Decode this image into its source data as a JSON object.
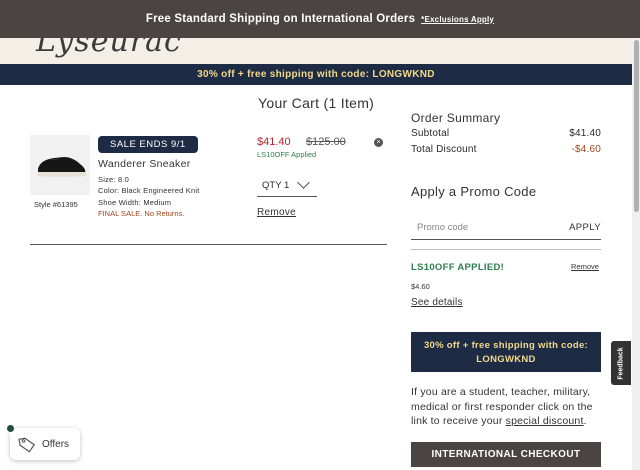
{
  "top_banner": {
    "text": "Free Standard Shipping on International Orders",
    "exclusions": "*Exclusions Apply"
  },
  "promo_bar": {
    "text": "30% off + free shipping with code: LONGWKND"
  },
  "cart": {
    "title": "Your Cart (1 Item)",
    "item": {
      "badge": "SALE ENDS 9/1",
      "name": "Wanderer Sneaker",
      "size": "Size: 8.0",
      "color": "Color: Black Engineered Knit",
      "width": "Shoe Width: Medium",
      "final_sale": "FINAL SALE. No Returns.",
      "style": "Style #61395",
      "sale_price": "$41.40",
      "original_price": "$125.00",
      "promo_applied": "LS10OFF Applied",
      "qty": "QTY 1",
      "remove": "Remove"
    }
  },
  "summary": {
    "title": "Order Summary",
    "subtotal_label": "Subtotal",
    "subtotal_value": "$41.40",
    "discount_label": "Total Discount",
    "discount_value": "-$4.60"
  },
  "promo": {
    "title": "Apply a Promo Code",
    "placeholder": "Promo code",
    "apply": "APPLY",
    "applied_label": "LS10OFF APPLIED!",
    "applied_remove": "Remove",
    "applied_amount": "$4.60",
    "see_details": "See details",
    "box_line1": "30% off + free shipping with code:",
    "box_line2": "LONGWKND"
  },
  "student": {
    "text": "If you are a student, teacher, military, medical or first responder click on the link to receive your ",
    "link": "special discount",
    "end": "."
  },
  "checkout": {
    "international": "INTERNATIONAL CHECKOUT"
  },
  "feedback": "Feedback",
  "offers": "Offers",
  "colors": {
    "navy": "#1e2b45",
    "gold": "#f2d98a",
    "sale_red": "#b3262d",
    "green": "#2e7d4f",
    "banner": "#4a4542"
  }
}
